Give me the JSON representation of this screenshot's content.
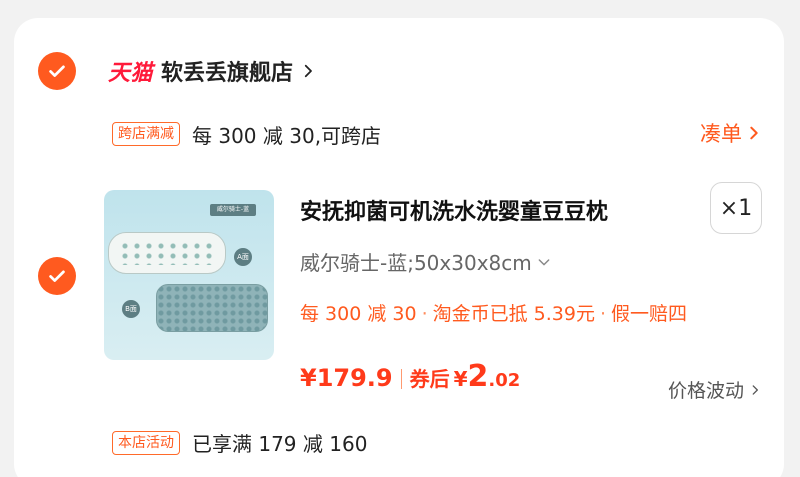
{
  "store": {
    "platform_logo": "天猫",
    "name": "软丢丢旗舰店",
    "selected": true
  },
  "promo": {
    "tag": "跨店满减",
    "text": "每 300 减 30,可跨店",
    "action": "凑单"
  },
  "item": {
    "selected": true,
    "title": "安抚抑菌可机洗水洗婴童豆豆枕",
    "quantity": "×1",
    "sku": "威尔骑士-蓝;50x30x8cm",
    "thumbnail": {
      "label": "威尔骑士-蓝",
      "badge_a": "A面",
      "badge_b": "B面"
    },
    "benefits": [
      "每 300 减 30",
      "淘金币已抵 5.39元",
      "假一赔四"
    ],
    "price": "¥179.9",
    "after_coupon_label": "券后",
    "after_coupon_currency": "¥",
    "after_coupon_int": "2",
    "after_coupon_dec": ".02",
    "price_fluctuation": "价格波动"
  },
  "store_activity": {
    "tag": "本店活动",
    "text": "已享满 179 减 160"
  },
  "colors": {
    "accent": "#ff5a1f",
    "price": "#ff3a1a",
    "tmall": "#ff1a3a"
  }
}
